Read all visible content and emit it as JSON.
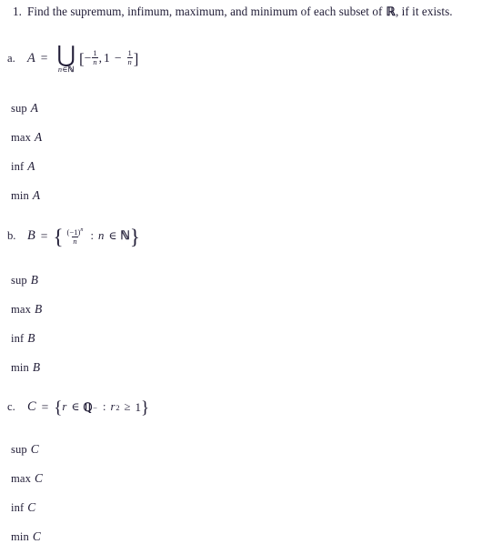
{
  "document": {
    "problem": {
      "number": "1.",
      "text": "Find the supremum, infimum, maximum, and minimum of each subset of ℝ, if it exists.",
      "text_before_symbol": "Find the supremum, infimum, maximum, and minimum of each subset of",
      "symbol": "ℝ",
      "text_after_symbol": ", if it exists."
    },
    "text_color": "#201c36",
    "background_color": "#ffffff",
    "parts": [
      {
        "marker": "a.",
        "set_name": "A",
        "equals": "=",
        "definition_plain": "A = ⋃_{n∈ℕ} [-1/n, 1 - 1/n]",
        "expression": {
          "kind": "big-union",
          "operator_symbol": "⋃",
          "operator_subscript": "n∈ℕ",
          "subscript_var": "n",
          "subscript_in": "∈",
          "subscript_set": "ℕ",
          "open_bracket": "[",
          "close_bracket": "]",
          "left_endpoint": {
            "sign": "−",
            "numerator": "1",
            "denominator": "n"
          },
          "separator": ",",
          "right_endpoint": {
            "leading": "1",
            "minus": "−",
            "numerator": "1",
            "denominator": "n"
          }
        },
        "answers": [
          {
            "operator": "sup",
            "argument": "A"
          },
          {
            "operator": "max",
            "argument": "A"
          },
          {
            "operator": "inf",
            "argument": "A"
          },
          {
            "operator": "min",
            "argument": "A"
          }
        ]
      },
      {
        "marker": "b.",
        "set_name": "B",
        "equals": "=",
        "definition_plain": "B = { (-1)^n / n : n ∈ ℕ }",
        "expression": {
          "kind": "set-builder-fraction",
          "open_brace": "{",
          "close_brace": "}",
          "numerator": "(−1)",
          "numerator_exponent": "n",
          "denominator": "n",
          "colon": ":",
          "condition_var": "n",
          "condition_in": "∈",
          "condition_set": "ℕ"
        },
        "answers": [
          {
            "operator": "sup",
            "argument": "B"
          },
          {
            "operator": "max",
            "argument": "B"
          },
          {
            "operator": "inf",
            "argument": "B"
          },
          {
            "operator": "min",
            "argument": "B"
          }
        ]
      },
      {
        "marker": "c.",
        "set_name": "C",
        "equals": "=",
        "definition_plain": "C = { r ∈ ℚ⁻ : r² ≥ 1 }",
        "expression": {
          "kind": "set-builder-condition",
          "open_brace": "{",
          "close_brace": "}",
          "element_var": "r",
          "element_in": "∈",
          "element_set": "ℚ",
          "element_set_superscript": "−",
          "colon": ":",
          "condition_var": "r",
          "condition_exponent": "2",
          "relation": "≥",
          "condition_value": "1"
        },
        "answers": [
          {
            "operator": "sup",
            "argument": "C"
          },
          {
            "operator": "max",
            "argument": "C"
          },
          {
            "operator": "inf",
            "argument": "C"
          },
          {
            "operator": "min",
            "argument": "C"
          }
        ]
      }
    ]
  }
}
